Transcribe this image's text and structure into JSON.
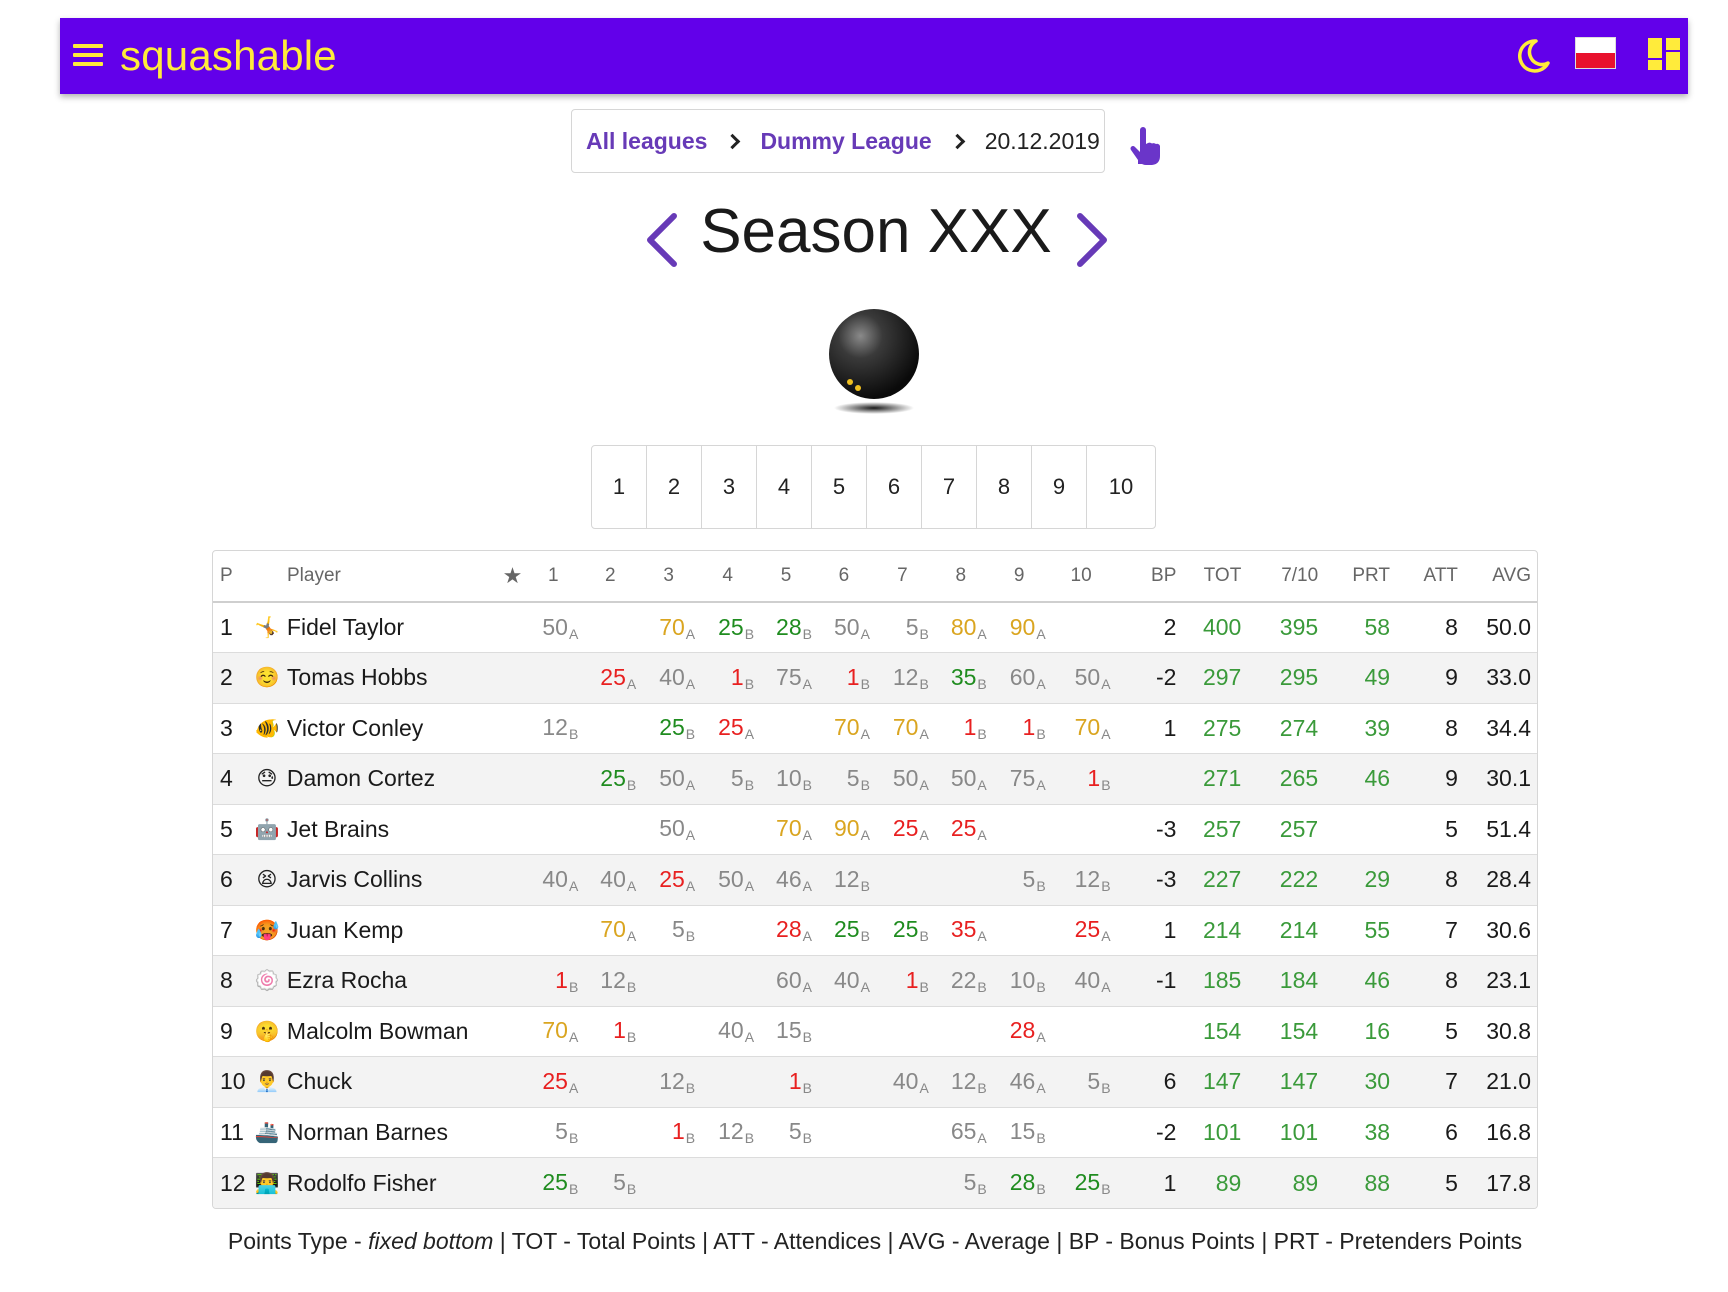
{
  "header": {
    "brand": "squashable",
    "colors": {
      "bar": "#6200ea",
      "accent": "#ffeb3b"
    },
    "icons": [
      "menu-icon",
      "moon-icon",
      "poland-flag-icon",
      "dashboard-icon"
    ]
  },
  "breadcrumb": {
    "all_leagues": "All leagues",
    "league": "Dummy League",
    "date": "20.12.2019"
  },
  "season": {
    "title": "Season XXX"
  },
  "rounds": [
    "1",
    "2",
    "3",
    "4",
    "5",
    "6",
    "7",
    "8",
    "9",
    "10"
  ],
  "table": {
    "columns": [
      "P",
      "Player",
      "★",
      "1",
      "2",
      "3",
      "4",
      "5",
      "6",
      "7",
      "8",
      "9",
      "10",
      "BP",
      "TOT",
      "7/10",
      "PRT",
      "ATT",
      "AVG"
    ],
    "rows": [
      {
        "p": "1",
        "emoji": "🤸",
        "name": "Fidel Taylor",
        "scores": [
          [
            "50",
            "A",
            "grey"
          ],
          null,
          [
            "70",
            "A",
            "orange"
          ],
          [
            "25",
            "B",
            "green"
          ],
          [
            "28",
            "B",
            "green"
          ],
          [
            "50",
            "A",
            "grey"
          ],
          [
            "5",
            "B",
            "grey"
          ],
          [
            "80",
            "A",
            "orange"
          ],
          [
            "90",
            "A",
            "orange"
          ],
          null
        ],
        "bp": "2",
        "tot": "400",
        "t710": "395",
        "prt": "58",
        "att": "8",
        "avg": "50.0"
      },
      {
        "p": "2",
        "emoji": "☺️",
        "name": "Tomas Hobbs",
        "scores": [
          null,
          [
            "25",
            "A",
            "red"
          ],
          [
            "40",
            "A",
            "grey"
          ],
          [
            "1",
            "B",
            "red"
          ],
          [
            "75",
            "A",
            "grey"
          ],
          [
            "1",
            "B",
            "red"
          ],
          [
            "12",
            "B",
            "grey"
          ],
          [
            "35",
            "B",
            "green"
          ],
          [
            "60",
            "A",
            "grey"
          ],
          [
            "50",
            "A",
            "grey"
          ]
        ],
        "bp": "-2",
        "tot": "297",
        "t710": "295",
        "prt": "49",
        "att": "9",
        "avg": "33.0"
      },
      {
        "p": "3",
        "emoji": "🐠",
        "name": "Victor Conley",
        "scores": [
          [
            "12",
            "B",
            "grey"
          ],
          null,
          [
            "25",
            "B",
            "green"
          ],
          [
            "25",
            "A",
            "red"
          ],
          null,
          [
            "70",
            "A",
            "orange"
          ],
          [
            "70",
            "A",
            "orange"
          ],
          [
            "1",
            "B",
            "red"
          ],
          [
            "1",
            "B",
            "red"
          ],
          [
            "70",
            "A",
            "orange"
          ]
        ],
        "bp": "1",
        "tot": "275",
        "t710": "274",
        "prt": "39",
        "att": "8",
        "avg": "34.4"
      },
      {
        "p": "4",
        "emoji": "😓",
        "name": "Damon Cortez",
        "scores": [
          null,
          [
            "25",
            "B",
            "green"
          ],
          [
            "50",
            "A",
            "grey"
          ],
          [
            "5",
            "B",
            "grey"
          ],
          [
            "10",
            "B",
            "grey"
          ],
          [
            "5",
            "B",
            "grey"
          ],
          [
            "50",
            "A",
            "grey"
          ],
          [
            "50",
            "A",
            "grey"
          ],
          [
            "75",
            "A",
            "grey"
          ],
          [
            "1",
            "B",
            "red"
          ]
        ],
        "bp": "",
        "tot": "271",
        "t710": "265",
        "prt": "46",
        "att": "9",
        "avg": "30.1"
      },
      {
        "p": "5",
        "emoji": "🤖",
        "name": "Jet Brains",
        "scores": [
          null,
          null,
          [
            "50",
            "A",
            "grey"
          ],
          null,
          [
            "70",
            "A",
            "orange"
          ],
          [
            "90",
            "A",
            "orange"
          ],
          [
            "25",
            "A",
            "red"
          ],
          [
            "25",
            "A",
            "red"
          ],
          null,
          null
        ],
        "bp": "-3",
        "tot": "257",
        "t710": "257",
        "prt": "",
        "att": "5",
        "avg": "51.4"
      },
      {
        "p": "6",
        "emoji": "😫",
        "name": "Jarvis Collins",
        "scores": [
          [
            "40",
            "A",
            "grey"
          ],
          [
            "40",
            "A",
            "grey"
          ],
          [
            "25",
            "A",
            "red"
          ],
          [
            "50",
            "A",
            "grey"
          ],
          [
            "46",
            "A",
            "grey"
          ],
          [
            "12",
            "B",
            "grey"
          ],
          null,
          null,
          [
            "5",
            "B",
            "grey"
          ],
          [
            "12",
            "B",
            "grey"
          ]
        ],
        "bp": "-3",
        "tot": "227",
        "t710": "222",
        "prt": "29",
        "att": "8",
        "avg": "28.4"
      },
      {
        "p": "7",
        "emoji": "🥵",
        "name": "Juan Kemp",
        "scores": [
          null,
          [
            "70",
            "A",
            "orange"
          ],
          [
            "5",
            "B",
            "grey"
          ],
          null,
          [
            "28",
            "A",
            "red"
          ],
          [
            "25",
            "B",
            "green"
          ],
          [
            "25",
            "B",
            "green"
          ],
          [
            "35",
            "A",
            "red"
          ],
          null,
          [
            "25",
            "A",
            "red"
          ]
        ],
        "bp": "1",
        "tot": "214",
        "t710": "214",
        "prt": "55",
        "att": "7",
        "avg": "30.6"
      },
      {
        "p": "8",
        "emoji": "🍥",
        "name": "Ezra Rocha",
        "scores": [
          [
            "1",
            "B",
            "red"
          ],
          [
            "12",
            "B",
            "grey"
          ],
          null,
          null,
          [
            "60",
            "A",
            "grey"
          ],
          [
            "40",
            "A",
            "grey"
          ],
          [
            "1",
            "B",
            "red"
          ],
          [
            "22",
            "B",
            "grey"
          ],
          [
            "10",
            "B",
            "grey"
          ],
          [
            "40",
            "A",
            "grey"
          ]
        ],
        "bp": "-1",
        "tot": "185",
        "t710": "184",
        "prt": "46",
        "att": "8",
        "avg": "23.1"
      },
      {
        "p": "9",
        "emoji": "🤫",
        "name": "Malcolm Bowman",
        "scores": [
          [
            "70",
            "A",
            "orange"
          ],
          [
            "1",
            "B",
            "red"
          ],
          null,
          [
            "40",
            "A",
            "grey"
          ],
          [
            "15",
            "B",
            "grey"
          ],
          null,
          null,
          null,
          [
            "28",
            "A",
            "red"
          ],
          null
        ],
        "bp": "",
        "tot": "154",
        "t710": "154",
        "prt": "16",
        "att": "5",
        "avg": "30.8"
      },
      {
        "p": "10",
        "emoji": "👨‍💼",
        "name": "Chuck",
        "scores": [
          [
            "25",
            "A",
            "red"
          ],
          null,
          [
            "12",
            "B",
            "grey"
          ],
          null,
          [
            "1",
            "B",
            "red"
          ],
          null,
          [
            "40",
            "A",
            "grey"
          ],
          [
            "12",
            "B",
            "grey"
          ],
          [
            "46",
            "A",
            "grey"
          ],
          [
            "5",
            "B",
            "grey"
          ]
        ],
        "bp": "6",
        "tot": "147",
        "t710": "147",
        "prt": "30",
        "att": "7",
        "avg": "21.0"
      },
      {
        "p": "11",
        "emoji": "🚢",
        "name": "Norman Barnes",
        "scores": [
          [
            "5",
            "B",
            "grey"
          ],
          null,
          [
            "1",
            "B",
            "red"
          ],
          [
            "12",
            "B",
            "grey"
          ],
          [
            "5",
            "B",
            "grey"
          ],
          null,
          null,
          [
            "65",
            "A",
            "grey"
          ],
          [
            "15",
            "B",
            "grey"
          ],
          null
        ],
        "bp": "-2",
        "tot": "101",
        "t710": "101",
        "prt": "38",
        "att": "6",
        "avg": "16.8"
      },
      {
        "p": "12",
        "emoji": "👨‍💻",
        "name": "Rodolfo Fisher",
        "scores": [
          [
            "25",
            "B",
            "green"
          ],
          [
            "5",
            "B",
            "grey"
          ],
          null,
          null,
          null,
          null,
          null,
          [
            "5",
            "B",
            "grey"
          ],
          [
            "28",
            "B",
            "green"
          ],
          [
            "25",
            "B",
            "green"
          ]
        ],
        "bp": "1",
        "tot": "89",
        "t710": "89",
        "prt": "88",
        "att": "5",
        "avg": "17.8"
      }
    ]
  },
  "legend": {
    "points_type_label": "Points Type - ",
    "points_type_value": "fixed bottom",
    "rest": " | TOT - Total Points | ATT - Attendices | AVG - Average | BP - Bonus Points | PRT - Pretenders Points"
  }
}
